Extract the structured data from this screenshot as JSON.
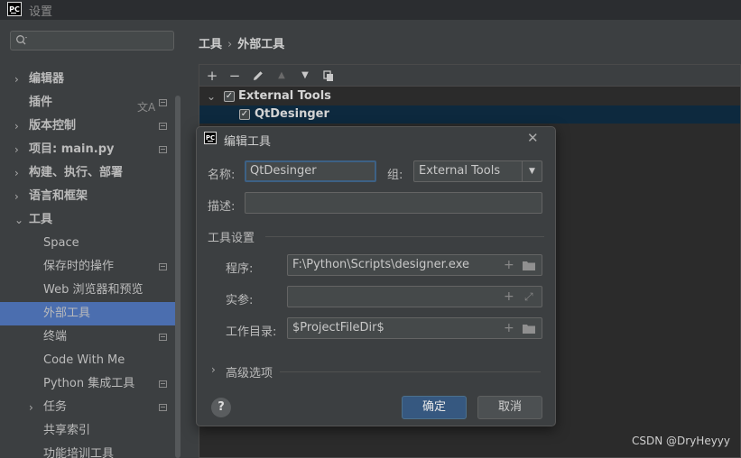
{
  "app": {
    "title": "设置",
    "logo_text": "PC"
  },
  "sidebar": {
    "items": [
      {
        "label": "编辑器",
        "bold": true,
        "arrow": "›"
      },
      {
        "label": "插件",
        "bold": true
      },
      {
        "label": "版本控制",
        "bold": true,
        "arrow": "›"
      },
      {
        "label": "项目: main.py",
        "bold": true,
        "arrow": "›"
      },
      {
        "label": "构建、执行、部署",
        "bold": true,
        "arrow": "›"
      },
      {
        "label": "语言和框架",
        "bold": true,
        "arrow": "›"
      },
      {
        "label": "工具",
        "bold": true,
        "arrow": "⌄"
      },
      {
        "label": "Space"
      },
      {
        "label": "保存时的操作"
      },
      {
        "label": "Web 浏览器和预览"
      },
      {
        "label": "外部工具"
      },
      {
        "label": "终端"
      },
      {
        "label": "Code With Me"
      },
      {
        "label": "Python 集成工具"
      },
      {
        "label": "任务",
        "arrow": "›"
      },
      {
        "label": "共享索引"
      },
      {
        "label": "功能培训工具"
      }
    ]
  },
  "breadcrumb": {
    "root": "工具",
    "sep": "›",
    "current": "外部工具"
  },
  "toolbar": {
    "add": "+",
    "remove": "−",
    "up": "▲",
    "down": "▼"
  },
  "tree": {
    "group": {
      "label": "External Tools",
      "checked": "✓",
      "arrow": "⌄"
    },
    "tool": {
      "label": "QtDesinger",
      "checked": "✓"
    }
  },
  "dialog": {
    "title": "编辑工具",
    "close": "✕",
    "name_label": "名称:",
    "name_value": "QtDesinger",
    "group_label": "组:",
    "group_value": "External Tools",
    "desc_label": "描述:",
    "desc_value": "",
    "section_label": "工具设置",
    "program_label": "程序:",
    "program_value": "F:\\Python\\Scripts\\designer.exe",
    "args_label": "实参:",
    "args_value": "",
    "workdir_label": "工作目录:",
    "workdir_value": "$ProjectFileDir$",
    "advanced_arrow": "›",
    "advanced_label": "高级选项",
    "help": "?",
    "ok": "确定",
    "cancel": "取消"
  },
  "watermark": "CSDN @DryHeyyy"
}
